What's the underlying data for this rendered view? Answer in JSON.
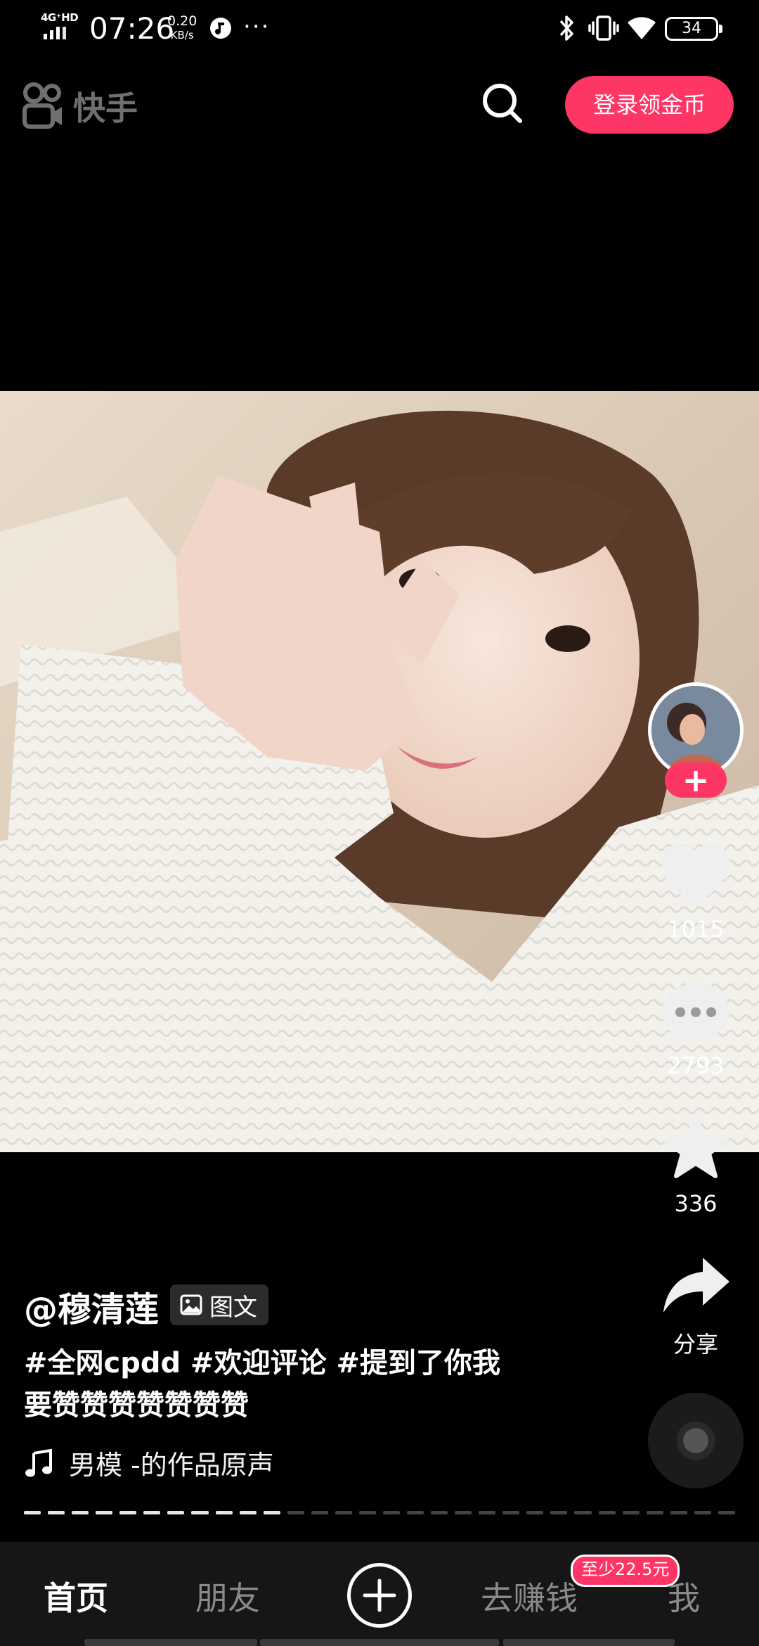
{
  "status_bar": {
    "network": "4G⁺HD",
    "time": "07:26",
    "speed_value": "0.20",
    "speed_unit": "KB/s",
    "more": "···",
    "battery": "34"
  },
  "header": {
    "app_name": "快手",
    "login_button": "登录领金币"
  },
  "post": {
    "author": "@穆清莲",
    "type_tag": "图文",
    "description_line1": "#全网cpdd #欢迎评论 #提到了你我",
    "description_line2": "要赞赞赞赞赞赞赞",
    "music": "男模 -的作品原声",
    "progress_fraction": 0.35
  },
  "actions": {
    "follow": "+",
    "likes": "1015",
    "comments": "2793",
    "favorites": "336",
    "share": "分享"
  },
  "nav": {
    "home": "首页",
    "friends": "朋友",
    "earn": "去赚钱",
    "earn_badge": "至少22.5元",
    "me": "我"
  },
  "colors": {
    "accent": "#fe3666",
    "background": "#000000",
    "nav_background": "#161616"
  }
}
